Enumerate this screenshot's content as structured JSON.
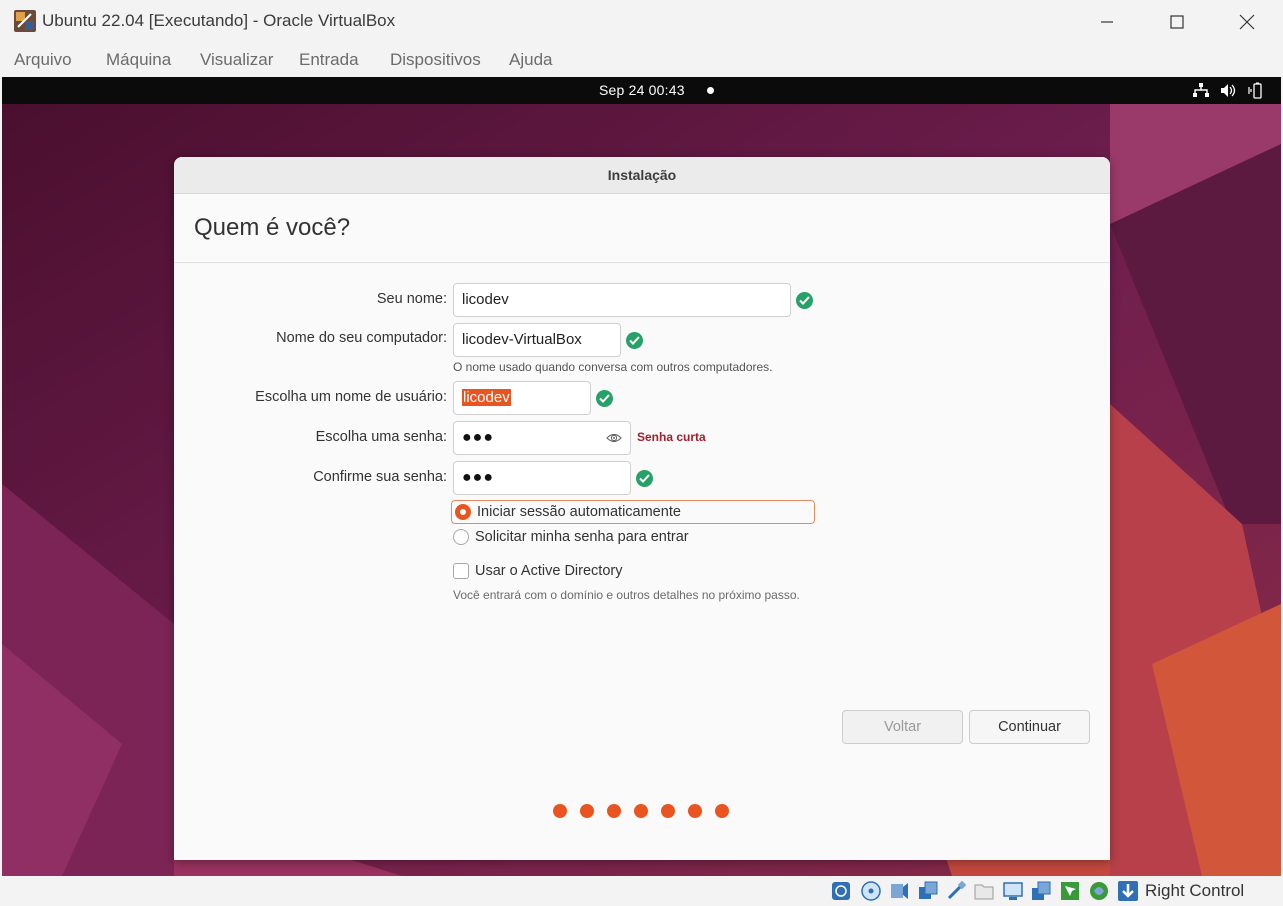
{
  "window": {
    "title": "Ubuntu 22.04 [Executando] - Oracle VirtualBox"
  },
  "menu": [
    "Arquivo",
    "Máquina",
    "Visualizar",
    "Entrada",
    "Dispositivos",
    "Ajuda"
  ],
  "guest_topbar": {
    "date_time": "Sep 24  00:43",
    "tray_icons": [
      "network-icon",
      "volume-icon",
      "battery-icon"
    ]
  },
  "installer": {
    "dialog_title": "Instalação",
    "heading": "Quem é você?",
    "fields": {
      "name": {
        "label": "Seu nome:",
        "value": "licodev",
        "valid": true
      },
      "computer": {
        "label": "Nome do seu computador:",
        "value": "licodev-VirtualBox",
        "valid": true,
        "hint": "O nome usado quando conversa com outros computadores."
      },
      "username": {
        "label": "Escolha um nome de usuário:",
        "value": "licodev",
        "valid": true
      },
      "password": {
        "label": "Escolha uma senha:",
        "value": "●●●",
        "strength": "Senha curta"
      },
      "confirm": {
        "label": "Confirme sua senha:",
        "value": "●●●",
        "valid": true
      }
    },
    "login_options": {
      "auto": {
        "label": "Iniciar sessão automaticamente",
        "selected": true
      },
      "password": {
        "label": "Solicitar minha senha para entrar",
        "selected": false
      }
    },
    "active_directory": {
      "label": "Usar o Active Directory",
      "checked": false,
      "hint": "Você entrará com o domínio e outros detalhes no próximo passo."
    },
    "buttons": {
      "back": "Voltar",
      "continue": "Continuar"
    },
    "progress_steps": 7
  },
  "statusbar": {
    "icons": [
      "hard-disk-icon",
      "optical-drive-icon",
      "audio-icon",
      "network-adapter-icon",
      "usb-icon",
      "shared-folders-icon",
      "display-icon",
      "recording-icon",
      "mouse-integration-icon",
      "guest-additions-icon",
      "host-key-icon"
    ],
    "host_key": "Right Control"
  },
  "colors": {
    "accent": "#e95420",
    "valid": "#26a269",
    "error": "#a51d2d"
  }
}
